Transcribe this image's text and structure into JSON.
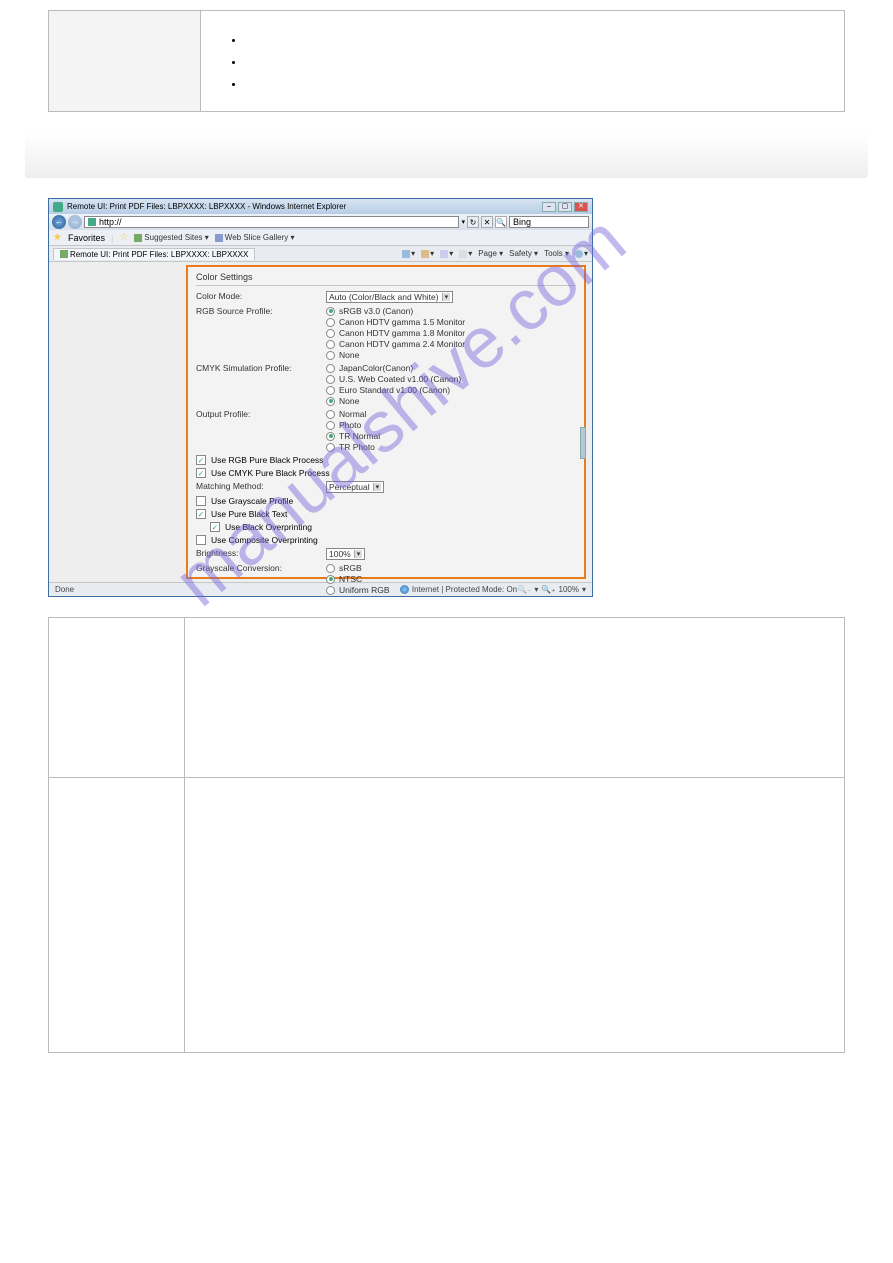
{
  "window": {
    "title": "Remote UI: Print PDF Files: LBPXXXX: LBPXXXX - Windows Internet Explorer",
    "url_scheme": "http://",
    "search_engine": "Bing",
    "fav_label": "Favorites",
    "fav_suggested": "Suggested Sites ▾",
    "fav_webslice": "Web Slice Gallery ▾",
    "tab_label": "Remote UI: Print PDF Files: LBPXXXX: LBPXXXX",
    "tools": {
      "page": "Page ▾",
      "safety": "Safety ▾",
      "tools": "Tools ▾"
    },
    "status_done": "Done",
    "status_zone": "Internet | Protected Mode: On",
    "zoom": "100%"
  },
  "panel": {
    "title": "Color Settings",
    "color_mode_label": "Color Mode:",
    "color_mode_value": "Auto (Color/Black and White)",
    "rgb_profile_label": "RGB Source Profile:",
    "rgb_profile_options": [
      "sRGB v3.0 (Canon)",
      "Canon HDTV gamma 1.5 Monitor",
      "Canon HDTV gamma 1.8 Monitor",
      "Canon HDTV gamma 2.4 Monitor",
      "None"
    ],
    "rgb_profile_selected": 0,
    "cmyk_profile_label": "CMYK Simulation Profile:",
    "cmyk_profile_options": [
      "JapanColor(Canon)",
      "U.S. Web Coated v1.00 (Canon)",
      "Euro Standard v1.00 (Canon)",
      "None"
    ],
    "cmyk_profile_selected": 3,
    "output_profile_label": "Output Profile:",
    "output_profile_options": [
      "Normal",
      "Photo",
      "TR Normal",
      "TR Photo"
    ],
    "output_profile_selected": 2,
    "chk_rgb_pure_black": "Use RGB Pure Black Process",
    "chk_cmyk_pure_black": "Use CMYK Pure Black Process",
    "matching_label": "Matching Method:",
    "matching_value": "Perceptual",
    "chk_grayscale_profile": "Use Grayscale Profile",
    "chk_pure_black_text": "Use Pure Black Text",
    "chk_black_overprint": "Use Black Overprinting",
    "chk_composite_overprint": "Use Composite Overprinting",
    "brightness_label": "Brightness:",
    "brightness_value": "100%",
    "grayscale_conv_label": "Grayscale Conversion:",
    "grayscale_conv_options": [
      "sRGB",
      "NTSC",
      "Uniform RGB"
    ],
    "grayscale_conv_selected": 1
  },
  "watermark": "manualshive.com"
}
